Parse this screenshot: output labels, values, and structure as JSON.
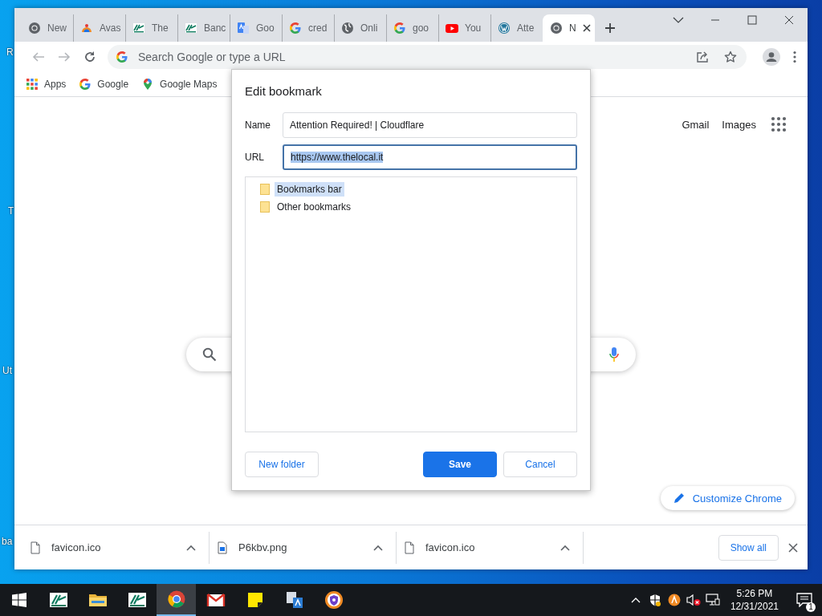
{
  "desktop": {
    "icon_labels": [
      "R",
      "T",
      "Ut",
      "ba"
    ]
  },
  "browser": {
    "tabs": [
      {
        "label": "New",
        "kind": "chrome",
        "selected": false
      },
      {
        "label": "Avas",
        "kind": "avast",
        "selected": false
      },
      {
        "label": "The",
        "kind": "ca",
        "selected": false
      },
      {
        "label": "Banc",
        "kind": "ca",
        "selected": false
      },
      {
        "label": "Goo",
        "kind": "translate",
        "selected": false
      },
      {
        "label": "cred",
        "kind": "google",
        "selected": false
      },
      {
        "label": "Onli",
        "kind": "globe",
        "selected": false
      },
      {
        "label": "goo",
        "kind": "google",
        "selected": false
      },
      {
        "label": "You",
        "kind": "youtube",
        "selected": false
      },
      {
        "label": "Atte",
        "kind": "wordpress",
        "selected": false
      },
      {
        "label": "N",
        "kind": "chrome",
        "selected": true
      }
    ],
    "nav_buttons": [
      {
        "kind": "back",
        "disabled": true
      },
      {
        "kind": "forward",
        "disabled": true
      },
      {
        "kind": "reload",
        "disabled": false
      }
    ],
    "omnibox": {
      "placeholder": "Search Google or type a URL"
    },
    "bookmarks_bar": [
      {
        "label": "Apps",
        "kind": "apps"
      },
      {
        "label": "Google",
        "kind": "google"
      },
      {
        "label": "Google Maps",
        "kind": "maps"
      }
    ],
    "page": {
      "links": [
        "Gmail",
        "Images"
      ],
      "customize_button": "Customize Chrome"
    },
    "dialog": {
      "title": "Edit bookmark",
      "fields": [
        {
          "label": "Name",
          "value": "Attention Required! | Cloudflare",
          "focused": false,
          "text_selected": false
        },
        {
          "label": "URL",
          "value": "https://www.thelocal.it",
          "focused": true,
          "text_selected": true
        }
      ],
      "folders": [
        {
          "label": "Bookmarks bar",
          "selected": true
        },
        {
          "label": "Other bookmarks",
          "selected": false
        }
      ],
      "buttons": [
        {
          "label": "New folder",
          "kind": "secondary"
        },
        {
          "label": "Save",
          "kind": "primary"
        },
        {
          "label": "Cancel",
          "kind": "secondary"
        }
      ]
    },
    "downloads": {
      "items": [
        {
          "name": "favicon.ico",
          "kind": "file"
        },
        {
          "name": "P6kbv.png",
          "kind": "image"
        },
        {
          "name": "favicon.ico",
          "kind": "file"
        }
      ],
      "show_all": "Show all"
    }
  },
  "taskbar": {
    "apps": [
      {
        "kind": "ca",
        "selected": false
      },
      {
        "kind": "folder",
        "selected": false
      },
      {
        "kind": "ca",
        "selected": false
      },
      {
        "kind": "chrome",
        "selected": true
      },
      {
        "kind": "gmail",
        "selected": false
      },
      {
        "kind": "sticky",
        "selected": false
      },
      {
        "kind": "translate",
        "selected": false
      },
      {
        "kind": "browser",
        "selected": false
      }
    ],
    "clock": {
      "time": "5:26 PM",
      "date": "12/31/2021"
    },
    "notification_count": "1"
  }
}
